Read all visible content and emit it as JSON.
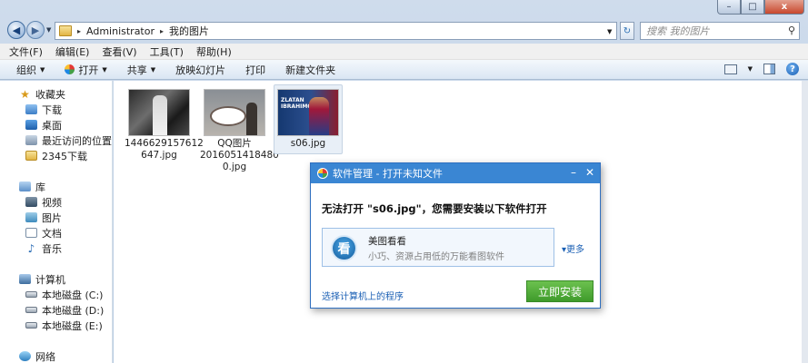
{
  "window": {
    "minimize_glyph": "–",
    "maximize_glyph": "□",
    "close_glyph": "x"
  },
  "address": {
    "crumbs": [
      "Administrator",
      "我的图片"
    ],
    "search_placeholder": "搜索 我的图片"
  },
  "menu": [
    "文件(F)",
    "编辑(E)",
    "查看(V)",
    "工具(T)",
    "帮助(H)"
  ],
  "commands": {
    "organize": "组织",
    "open": "打开",
    "share": "共享",
    "slideshow": "放映幻灯片",
    "print": "打印",
    "new_folder": "新建文件夹"
  },
  "nav": {
    "favorites": "收藏夹",
    "downloads": "下载",
    "desktop": "桌面",
    "recent": "最近访问的位置",
    "folder_2345": "2345下载",
    "libraries": "库",
    "videos": "视频",
    "pictures": "图片",
    "documents": "文档",
    "music": "音乐",
    "computer": "计算机",
    "drive_c": "本地磁盘 (C:)",
    "drive_d": "本地磁盘 (D:)",
    "drive_e": "本地磁盘 (E:)",
    "network": "网络"
  },
  "files": [
    {
      "name_line1": "1446629157612",
      "name_line2": "647.jpg",
      "name_line3": ""
    },
    {
      "name_line1": "QQ图片",
      "name_line2": "2016051418480",
      "name_line3": "0.jpg"
    },
    {
      "name_line1": "s06.jpg",
      "name_line2": "",
      "name_line3": ""
    }
  ],
  "thumb_text": {
    "t3_line1": "ZLATAN",
    "t3_line2": "IBRAHIMOVIC"
  },
  "dialog": {
    "title": "软件管理 - 打开未知文件",
    "message": "无法打开 \"s06.jpg\"，您需要安装以下软件打开",
    "app_icon_text": "看",
    "app_name": "美图看看",
    "app_desc": "小巧、资源占用低的万能看图软件",
    "more": "更多",
    "choose_link": "选择计算机上的程序",
    "install_button": "立即安装"
  }
}
